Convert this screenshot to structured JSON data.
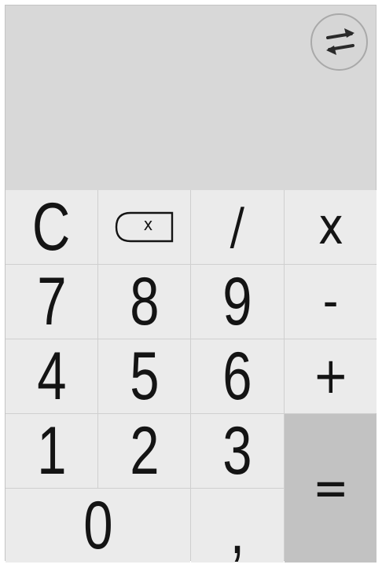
{
  "display": {
    "swap_icon": "swap-arrows-icon"
  },
  "keys": {
    "clear": "C",
    "backspace_icon": "backspace-icon",
    "backspace_glyph": "x",
    "divide": "/",
    "multiply": "x",
    "seven": "7",
    "eight": "8",
    "nine": "9",
    "minus": "-",
    "four": "4",
    "five": "5",
    "six": "6",
    "plus": "+",
    "one": "1",
    "two": "2",
    "three": "3",
    "equals": "=",
    "zero": "0",
    "comma": ","
  },
  "colors": {
    "display_bg": "#d8d8d8",
    "key_bg": "#ebebeb",
    "equals_bg": "#c2c2c2",
    "key_text": "#141414"
  }
}
